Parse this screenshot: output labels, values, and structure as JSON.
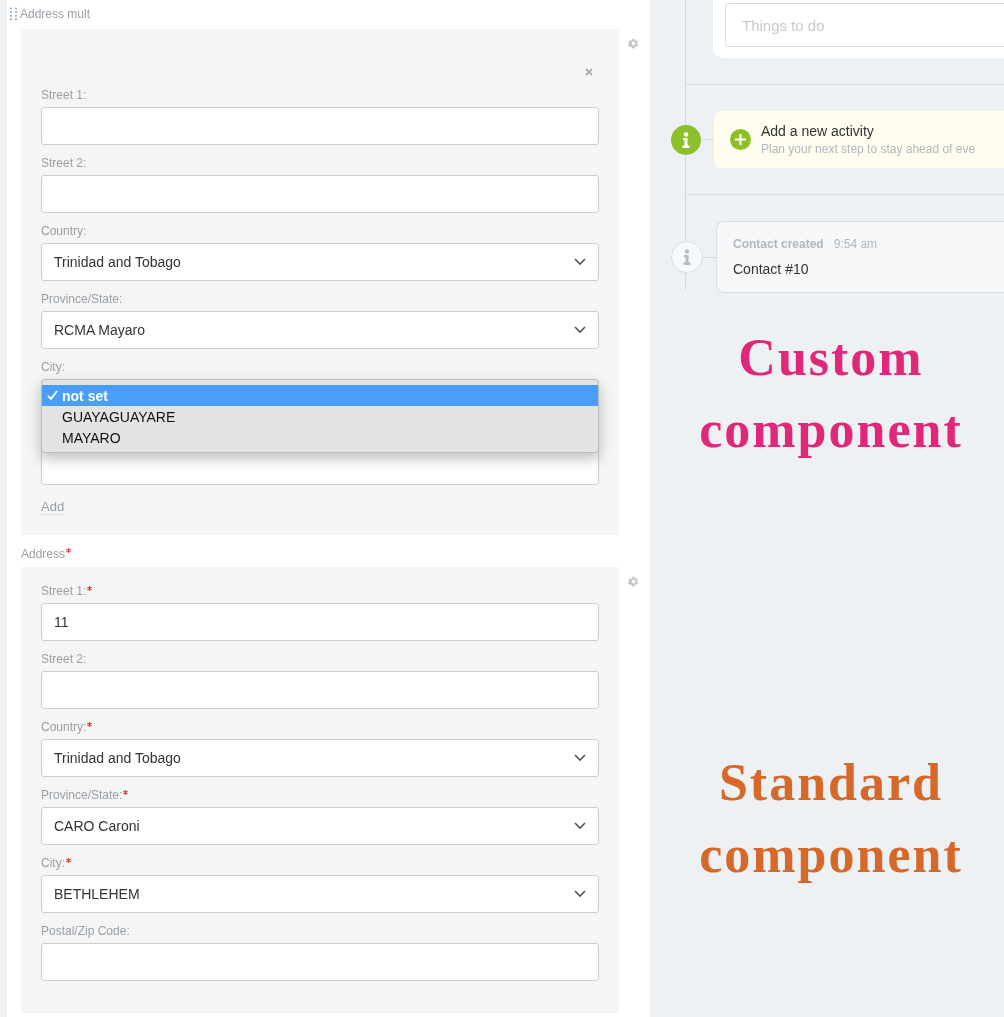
{
  "multi_address": {
    "title": "Address mult",
    "entry": {
      "fields": [
        {
          "kind": "text",
          "label": "Street 1:"
        },
        {
          "kind": "text",
          "label": "Street 2:"
        },
        {
          "kind": "select",
          "label": "Country:",
          "value": "Trinidad and Tobago"
        },
        {
          "kind": "select",
          "label": "Province/State:",
          "value": "RCMA Mayaro"
        },
        {
          "kind": "open_select",
          "label": "City:",
          "options": [
            {
              "label": "not set",
              "selected": true
            },
            {
              "label": "GUAYAGUAYARE",
              "selected": false
            },
            {
              "label": "MAYARO",
              "selected": false
            }
          ]
        },
        {
          "kind": "text"
        }
      ]
    },
    "add_link": "Add"
  },
  "address": {
    "title": "Address",
    "required": true,
    "fields": [
      {
        "kind": "text",
        "label": "Street 1:",
        "required": true,
        "value": "11"
      },
      {
        "kind": "text",
        "label": "Street 2:",
        "required": false
      },
      {
        "kind": "select",
        "label": "Country:",
        "required": true,
        "value": "Trinidad and Tobago"
      },
      {
        "kind": "select",
        "label": "Province/State:",
        "required": true,
        "value": "CARO Caroni"
      },
      {
        "kind": "select",
        "label": "City:",
        "required": true,
        "value": "BETHLEHEM"
      },
      {
        "kind": "text",
        "label": "Postal/Zip Code:",
        "required": false
      }
    ]
  },
  "timeline": {
    "todo_placeholder": "Things to do",
    "add_activity": {
      "title": "Add a new activity",
      "subtitle": "Plan your next step to stay ahead of eve"
    },
    "event": {
      "title": "Contact created",
      "time": "9:54 am",
      "body": "Contact #10"
    }
  },
  "annotations": [
    {
      "text": "Custom component",
      "color": "#e0287a"
    },
    {
      "text": "Standard component",
      "color": "#d6692a"
    }
  ]
}
